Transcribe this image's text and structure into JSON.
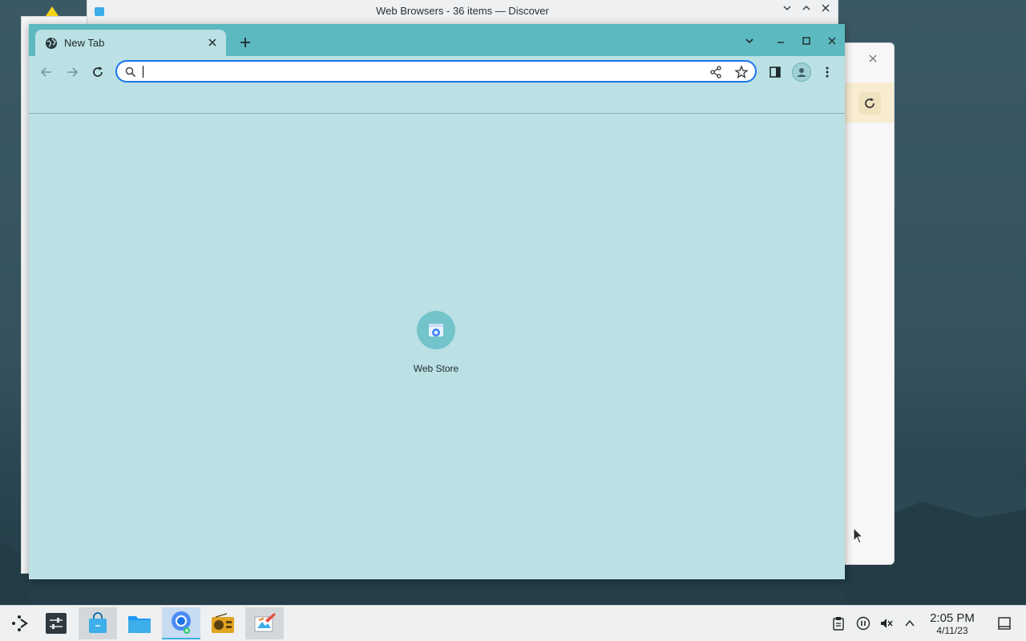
{
  "discover_window": {
    "title": "Web Browsers - 36 items — Discover",
    "controls": [
      "chevron-down-icon",
      "chevron-up-icon",
      "close-icon"
    ]
  },
  "chrome": {
    "tab": {
      "title": "New Tab",
      "favicon": "globe-icon"
    },
    "new_tab_symbol": "+",
    "omnibox": {
      "value": "",
      "placeholder": ""
    },
    "shortcuts": [
      {
        "label": "Web Store",
        "icon": "web-store-icon"
      }
    ],
    "colors": {
      "frame": "#5cb9c0",
      "page_background": "#bbe1e5",
      "omnibox_focus_ring": "#1a73e8"
    }
  },
  "taskbar": {
    "apps": [
      {
        "name": "application-launcher",
        "icon": "launcher-icon"
      },
      {
        "name": "system-settings",
        "icon": "settings-sliders-icon"
      },
      {
        "name": "discover",
        "icon": "store-bag-icon"
      },
      {
        "name": "dolphin",
        "icon": "folder-icon"
      },
      {
        "name": "chromium",
        "icon": "chromium-icon"
      },
      {
        "name": "radio",
        "icon": "radio-icon"
      },
      {
        "name": "paint",
        "icon": "paint-icon"
      }
    ],
    "tray": [
      "clipboard-icon",
      "media-pause-icon",
      "volume-muted-icon",
      "chevron-up-icon"
    ],
    "clock": {
      "time": "2:05 PM",
      "date": "4/11/23"
    }
  }
}
